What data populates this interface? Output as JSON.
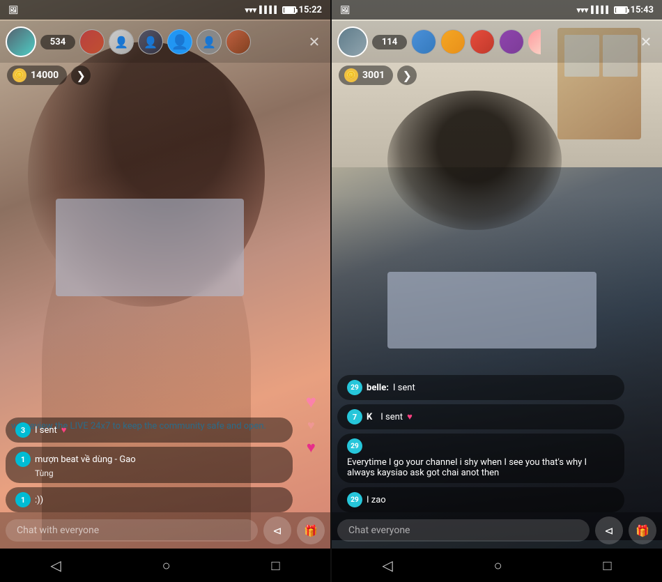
{
  "screen_left": {
    "status_bar": {
      "time": "15:22",
      "signal": true,
      "battery": true
    },
    "viewer_count": "534",
    "coins": "14000",
    "chat_input_placeholder": "Chat with everyone",
    "community_text": "will review the LIVE 24x7 to keep the community safe and open.",
    "messages": [
      {
        "badge": "3",
        "text": "I sent",
        "has_heart": true
      },
      {
        "badge": "1",
        "text": "mượn beat về dùng - Gao",
        "sender": "Tùng"
      },
      {
        "badge": "1",
        "text": ":))"
      }
    ],
    "viewers": [
      {
        "color": "av2"
      },
      {
        "color": "av3"
      },
      {
        "color": "av4"
      },
      {
        "color": "user-blue",
        "is_user": true
      },
      {
        "color": "silhouette"
      },
      {
        "color": "av5"
      }
    ]
  },
  "screen_right": {
    "status_bar": {
      "time": "15:43",
      "signal": true,
      "battery": true
    },
    "viewer_count": "114",
    "coins": "3001",
    "chat_input_placeholder": "Chat everyone",
    "messages": [
      {
        "badge": "29",
        "sender": "belle",
        "text": "I sent"
      },
      {
        "badge": "7",
        "sender": "K",
        "text": "I sent",
        "has_heart": true
      },
      {
        "badge": "29",
        "text": "Everytime I go your channel i shy when I see you that's why I always kaysiao ask got chai anot then"
      },
      {
        "badge": "29",
        "text": "I zao"
      }
    ],
    "viewers": [
      {
        "color": "av3"
      },
      {
        "color": "av7"
      },
      {
        "color": "av8"
      },
      {
        "color": "av5"
      },
      {
        "color": "partial"
      }
    ]
  },
  "nav": {
    "back": "◁",
    "home": "○",
    "recents": "□"
  },
  "icons": {
    "share": "⊲",
    "gift": "🎁",
    "close": "✕",
    "coin": "🪙",
    "heart": "♥",
    "arrow_right": "❯"
  }
}
